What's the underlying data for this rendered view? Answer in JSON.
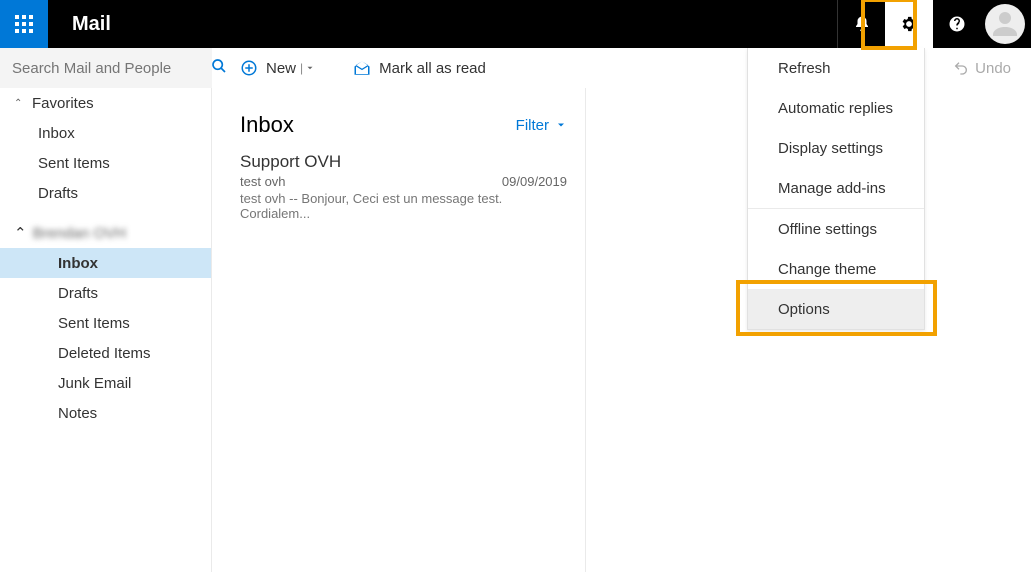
{
  "header": {
    "app_title": "Mail"
  },
  "search": {
    "placeholder": "Search Mail and People"
  },
  "toolbar": {
    "new_label": "New",
    "markall_label": "Mark all as read",
    "undo_label": "Undo"
  },
  "sidebar": {
    "favorites_label": "Favorites",
    "fav_items": [
      "Inbox",
      "Sent Items",
      "Drafts"
    ],
    "account_name": "Brendan OVH",
    "folders": [
      "Inbox",
      "Drafts",
      "Sent Items",
      "Deleted Items",
      "Junk Email",
      "Notes"
    ]
  },
  "list": {
    "title": "Inbox",
    "filter_label": "Filter",
    "messages": [
      {
        "from": "Support OVH",
        "subject": "test ovh",
        "date": "09/09/2019",
        "preview": "test ovh -- Bonjour, Ceci est un message test. Cordialem..."
      }
    ]
  },
  "settings_menu": {
    "items": [
      "Refresh",
      "Automatic replies",
      "Display settings",
      "Manage add-ins",
      "Offline settings",
      "Change theme",
      "Options"
    ]
  }
}
